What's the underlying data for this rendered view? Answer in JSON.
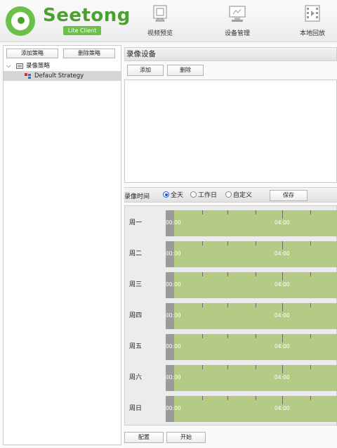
{
  "app": {
    "logo_text": "Seetong",
    "logo_badge": "Lite Client"
  },
  "nav": [
    {
      "label": "视频预览",
      "icon": "video-preview-icon"
    },
    {
      "label": "设备管理",
      "icon": "device-manage-icon"
    },
    {
      "label": "本地回放",
      "icon": "local-playback-icon"
    }
  ],
  "left_panel": {
    "add_label": "添加策略",
    "delete_label": "删除策略",
    "tree": {
      "root_label": "录像策略",
      "child_label": "Default Strategy"
    }
  },
  "record_device": {
    "title": "录像设备",
    "add_label": "添加",
    "delete_label": "删除"
  },
  "record_time": {
    "label": "录像时间",
    "options": [
      "全天",
      "工作日",
      "自定义"
    ],
    "selected": "全天",
    "save_label": "保存"
  },
  "schedule": {
    "days": [
      "周一",
      "周二",
      "周三",
      "周四",
      "周五",
      "周六",
      "周日"
    ],
    "start_label": "00:00",
    "mid_label": "04:00",
    "colors": {
      "active": "#b5ca84",
      "inactive": "#9b9b9b"
    }
  },
  "footer": {
    "config_label": "配置",
    "start_label": "开始"
  }
}
